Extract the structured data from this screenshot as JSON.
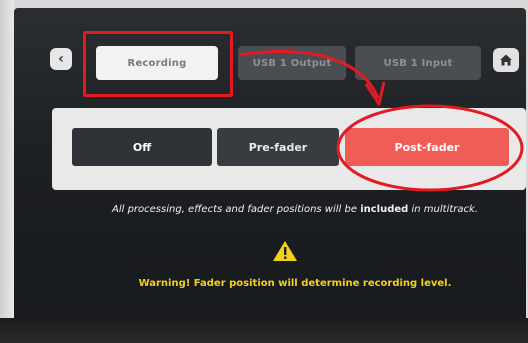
{
  "tabs": [
    {
      "label": "Recording",
      "active": true
    },
    {
      "label": "USB 1 Output",
      "active": false
    },
    {
      "label": "USB 1 Input",
      "active": false
    }
  ],
  "nav": {
    "back_icon": "chevron-left-icon",
    "home_icon": "home-icon"
  },
  "options": [
    {
      "label": "Off",
      "selected": false
    },
    {
      "label": "Pre-fader",
      "selected": false
    },
    {
      "label": "Post-fader",
      "selected": true
    }
  ],
  "info": {
    "part1": "All processing, effects and fader positions will be ",
    "emphasis": "included",
    "part2": " in multitrack."
  },
  "warning": {
    "icon": "warning-triangle-icon",
    "text": "Warning! Fader position will determine recording level."
  },
  "colors": {
    "selected": "#ef5d56",
    "warning": "#f1d21a",
    "annotation": "#e21b23"
  }
}
